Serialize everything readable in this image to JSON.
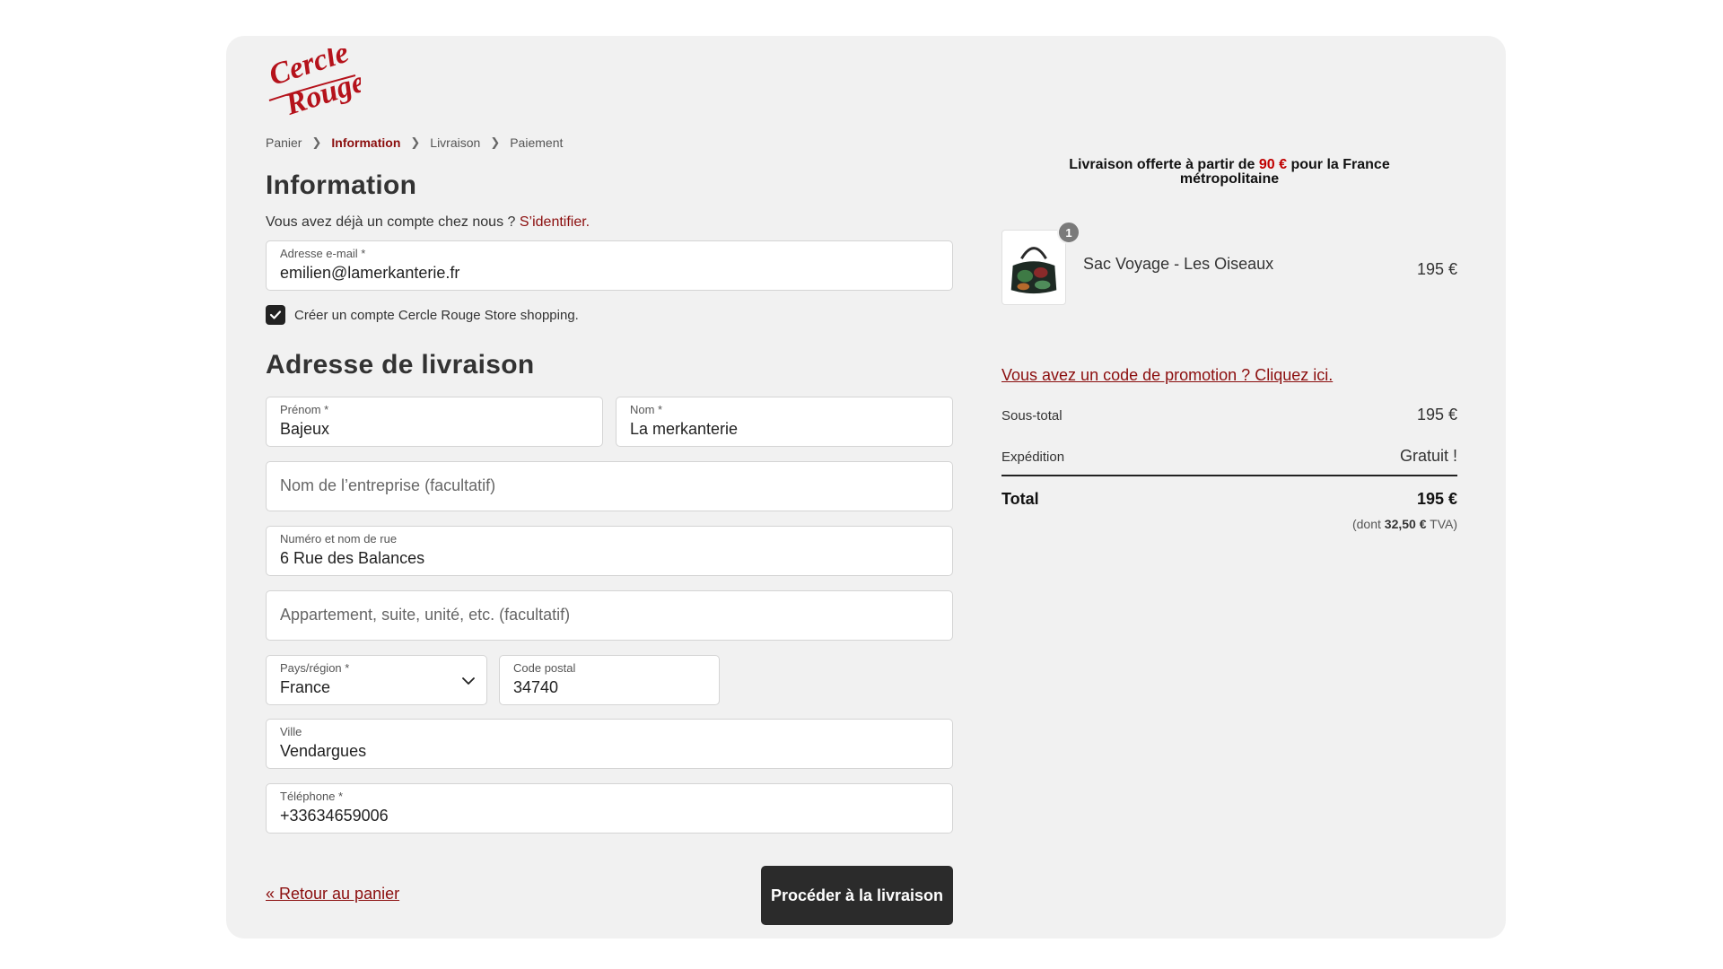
{
  "brand": {
    "name": "Cercle Rouge",
    "line1": "Cercle",
    "line2": "Rouge",
    "color": "#b5121b"
  },
  "breadcrumb": {
    "items": [
      {
        "label": "Panier",
        "active": false
      },
      {
        "label": "Information",
        "active": true
      },
      {
        "label": "Livraison",
        "active": false
      },
      {
        "label": "Paiement",
        "active": false
      }
    ],
    "separator_icon": "chevron-right-icon"
  },
  "information": {
    "title": "Information",
    "login_prompt": "Vous avez déjà un compte chez nous ? ",
    "login_link": "S’identifier.",
    "email": {
      "label": "Adresse e-mail *",
      "value": "emilien@lamerkanterie.fr"
    },
    "create_account": {
      "label": "Créer un compte Cercle Rouge Store shopping.",
      "checked": true
    }
  },
  "shipping_address": {
    "title": "Adresse de livraison",
    "first_name": {
      "label": "Prénom *",
      "value": "Bajeux"
    },
    "last_name": {
      "label": "Nom *",
      "value": "La merkanterie"
    },
    "company": {
      "placeholder": "Nom de l’entreprise (facultatif)"
    },
    "street": {
      "label": "Numéro et nom de rue",
      "value": "6 Rue des Balances"
    },
    "apartment": {
      "placeholder": "Appartement, suite, unité, etc. (facultatif)"
    },
    "country": {
      "label": "Pays/région *",
      "value": "France"
    },
    "postal_code": {
      "label": "Code postal",
      "value": "34740"
    },
    "city": {
      "label": "Ville",
      "value": "Vendargues"
    },
    "phone": {
      "label": "Téléphone *",
      "value": "+33634659006"
    }
  },
  "actions": {
    "back_label": "« Retour au panier",
    "proceed_label": "Procéder à la livraison"
  },
  "summary": {
    "shipping_banner": {
      "prefix": "Livraison offerte à partir de ",
      "amount": "90 €",
      "suffix": " pour la France",
      "line2": "métropolitaine"
    },
    "product": {
      "name": "Sac Voyage - Les Oiseaux",
      "price": "195 €",
      "quantity": "1"
    },
    "promo_link": "Vous avez un code de promotion ? Cliquez ici.",
    "subtotal": {
      "label": "Sous-total",
      "value": "195 €"
    },
    "shipping": {
      "label": "Expédition",
      "value": "Gratuit !"
    },
    "total": {
      "label": "Total",
      "value": "195 €"
    },
    "vat": {
      "prefix": "(dont ",
      "amount": "32,50 €",
      "suffix": " TVA)"
    }
  },
  "colors": {
    "accent": "#8b0e0e",
    "button": "#2b2b2b",
    "card_bg": "#f1f1f1"
  }
}
